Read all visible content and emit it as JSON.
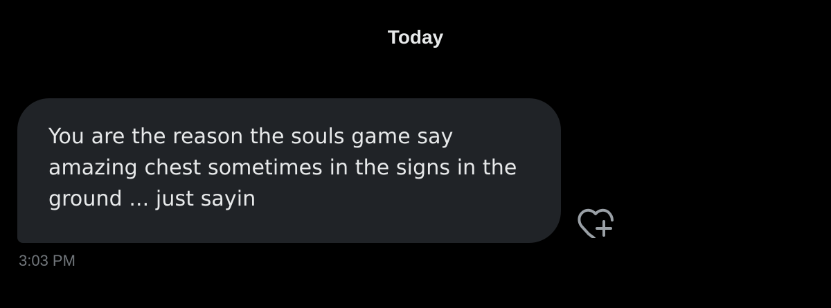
{
  "day_separator": {
    "label": "Today"
  },
  "message": {
    "text": "You are the reason the souls game say amazing chest sometimes in the signs in the ground ... just sayin",
    "timestamp": "3:03 PM",
    "bubble_color": "#202327",
    "text_color": "#e7e9ea"
  },
  "react_button": {
    "icon": "heart-plus-icon",
    "color": "#9aa0a6"
  },
  "colors": {
    "background": "#000000",
    "timestamp": "#71767b"
  }
}
